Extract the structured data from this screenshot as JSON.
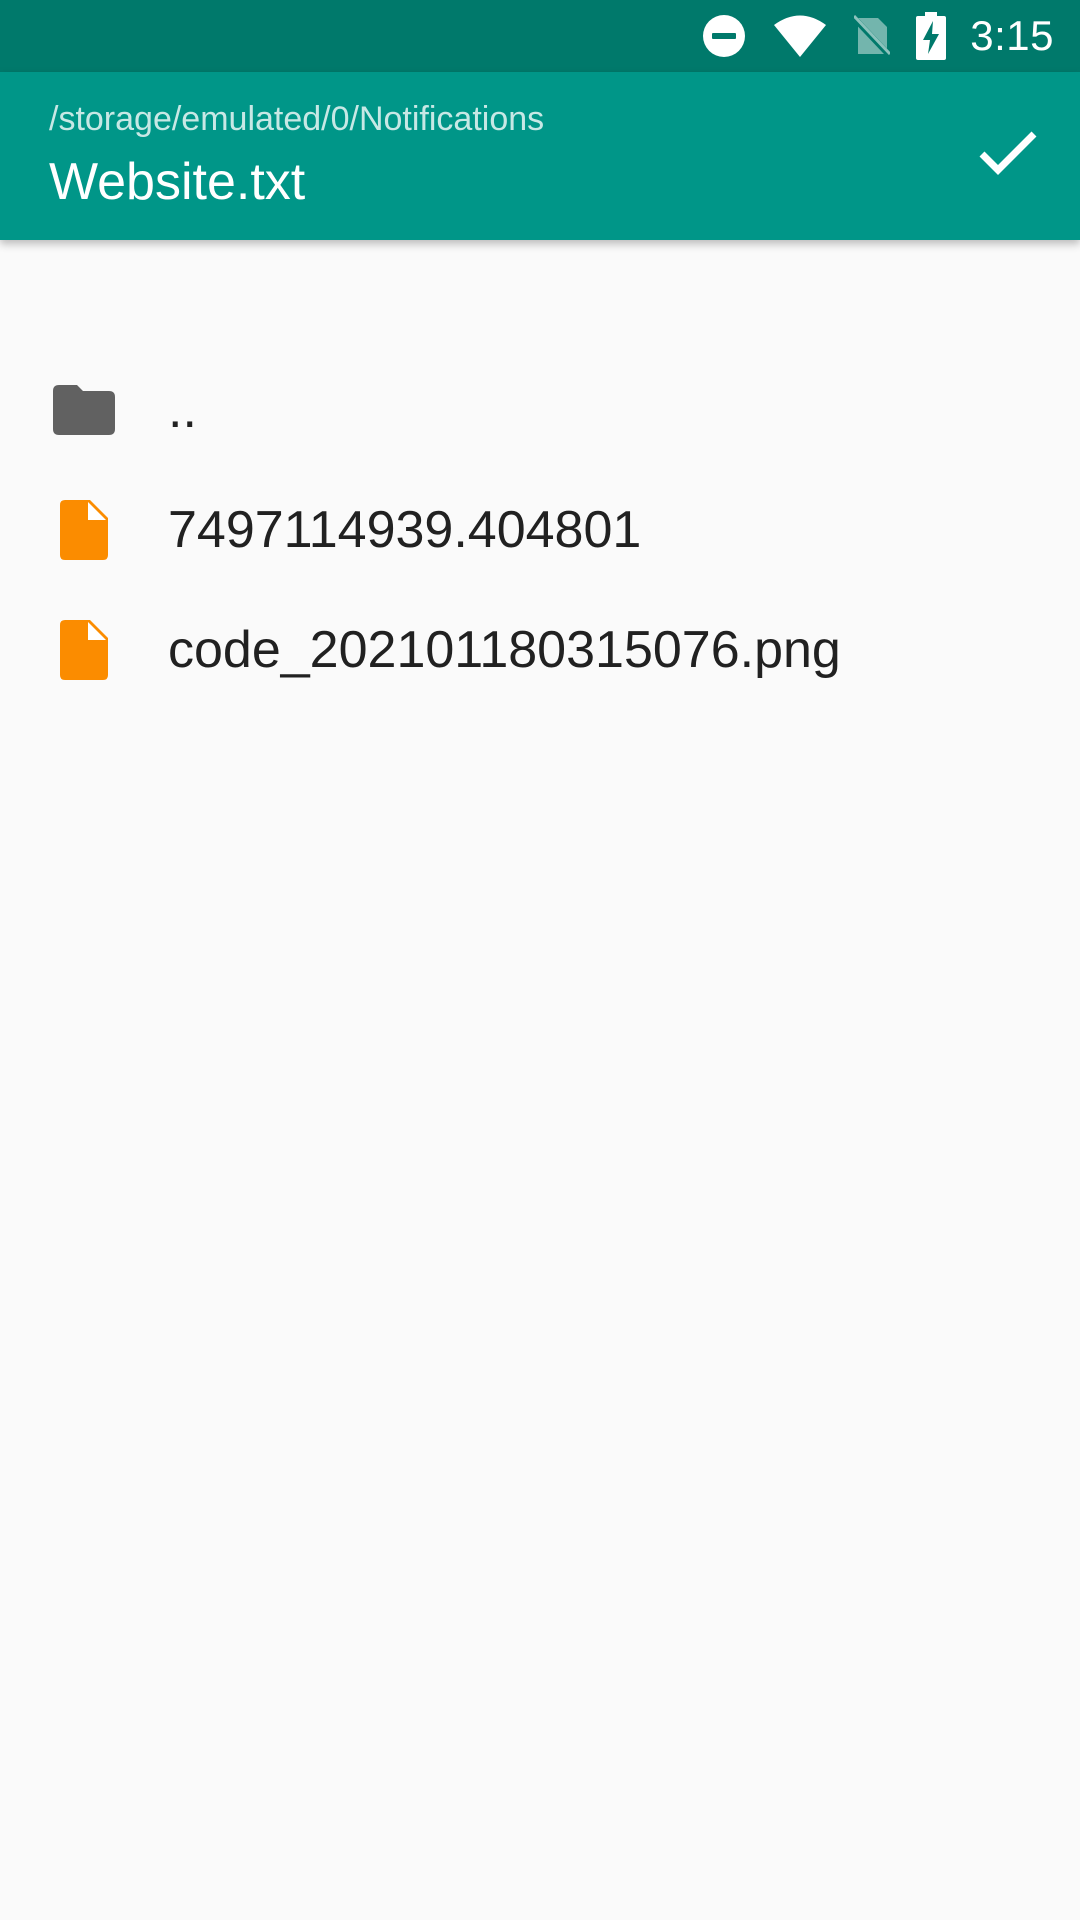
{
  "status_bar": {
    "time": "3:15",
    "icons": [
      "do-not-disturb-icon",
      "wifi-icon",
      "no-sim-icon",
      "battery-charging-icon"
    ]
  },
  "app_bar": {
    "path": "/storage/emulated/0/Notifications",
    "title": "Website.txt",
    "confirm_icon": "check-icon"
  },
  "files": [
    {
      "name": "..",
      "icon": "folder-icon"
    },
    {
      "name": "7497114939.404801",
      "icon": "file-icon"
    },
    {
      "name": "code_202101180315076.png",
      "icon": "file-icon"
    }
  ],
  "colors": {
    "status_bar": "#00796b",
    "app_bar": "#009688",
    "background": "#fafafa",
    "folder": "#616161",
    "file": "#fb8c00",
    "text": "#212121"
  }
}
